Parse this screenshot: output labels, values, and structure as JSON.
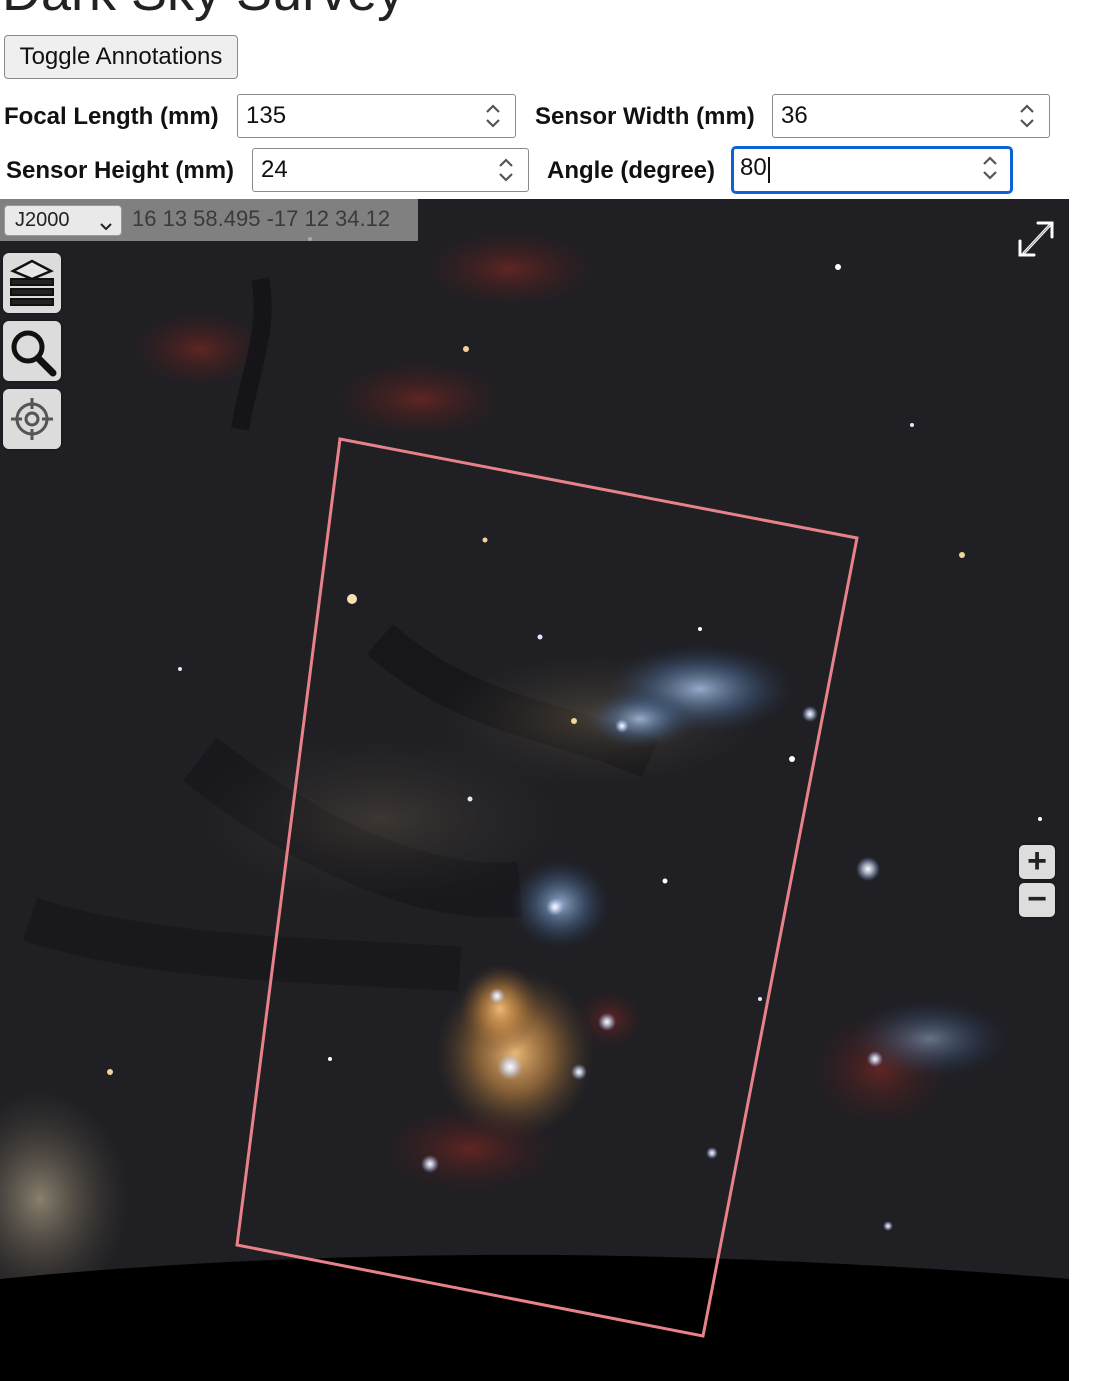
{
  "page": {
    "title": "Dark Sky Survey"
  },
  "toggle_annotations": {
    "label": "Toggle Annotations"
  },
  "fields": {
    "focal_length": {
      "label": "Focal Length (mm)",
      "value": "135"
    },
    "sensor_width": {
      "label": "Sensor Width (mm)",
      "value": "36"
    },
    "sensor_height": {
      "label": "Sensor Height (mm)",
      "value": "24"
    },
    "angle": {
      "label": "Angle (degree)",
      "value": "80"
    }
  },
  "viewer": {
    "frame_select": {
      "selected": "J2000",
      "icon": "chevron-down-icon"
    },
    "coordinates": "16 13 58.495 -17 12 34.12",
    "tools": [
      {
        "name": "layers",
        "icon": "layers-icon"
      },
      {
        "name": "search",
        "icon": "search-icon"
      },
      {
        "name": "target",
        "icon": "crosshair-icon"
      }
    ],
    "fullscreen_icon": "expand-icon",
    "zoom_in_label": "+",
    "zoom_out_label": "−",
    "fov_outline_color": "#e8828a",
    "sky_color": "#1c1c20",
    "horizon_color": "#000000"
  }
}
